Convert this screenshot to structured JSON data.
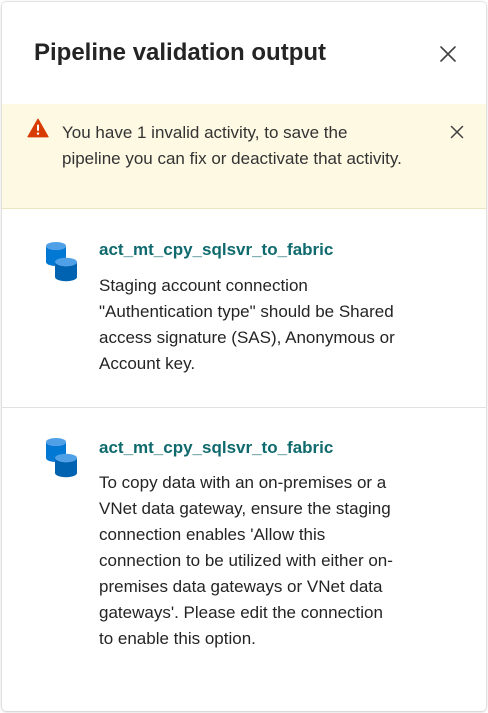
{
  "panel": {
    "title": "Pipeline validation output",
    "close_icon": "close-icon"
  },
  "warning": {
    "icon": "warning-triangle-icon",
    "message": "You have 1 invalid activity, to save the pipeline you can fix or deactivate that activity.",
    "dismiss_icon": "dismiss-icon",
    "color": "#d83b01",
    "background": "#fdf9e3"
  },
  "items": [
    {
      "icon": "copy-activity-icon",
      "activity_name": "act_mt_cpy_sqlsvr_to_fabric",
      "message": "Staging account connection \"Authentication type\" should be Shared access signature (SAS), Anonymous or Account key."
    },
    {
      "icon": "copy-activity-icon",
      "activity_name": "act_mt_cpy_sqlsvr_to_fabric",
      "message": "To copy data with an on-premises or a VNet data gateway, ensure the staging connection enables 'Allow this connection to be utilized with either on-premises data gateways or VNet data gateways'. Please edit the connection to enable this option."
    }
  ],
  "colors": {
    "link": "#0f6a6e",
    "icon_blue": "#0078d4"
  }
}
